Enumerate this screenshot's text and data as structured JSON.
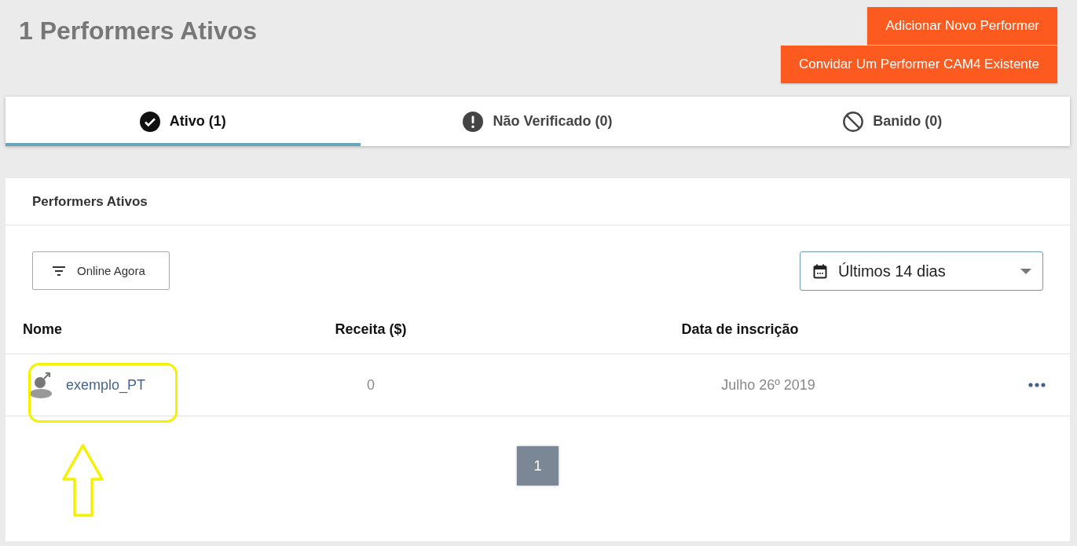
{
  "page_title": "1 Performers Ativos",
  "actions": [
    {
      "label": "Adicionar Novo Performer"
    },
    {
      "label": "Convidar Um Performer CAM4 Existente"
    }
  ],
  "tabs": [
    {
      "label": "Ativo (1)",
      "kind": "check",
      "selected": true
    },
    {
      "label": "Não Verificado (0)",
      "kind": "alert",
      "selected": false
    },
    {
      "label": "Banido (0)",
      "kind": "ban",
      "selected": false
    }
  ],
  "card": {
    "title": "Performers Ativos",
    "filter_button": {
      "label": "Online Agora"
    },
    "date_range": {
      "value": "Últimos 14 dias"
    },
    "table": {
      "columns": [
        "Nome",
        "Receita ($)",
        "Data de inscrição"
      ],
      "rows": [
        {
          "name": "exemplo_PT",
          "revenue": "0",
          "signup_date": "Julho 26º 2019",
          "highlighted": true
        }
      ]
    },
    "pagination": [
      {
        "label": "1",
        "selected": true
      }
    ]
  }
}
